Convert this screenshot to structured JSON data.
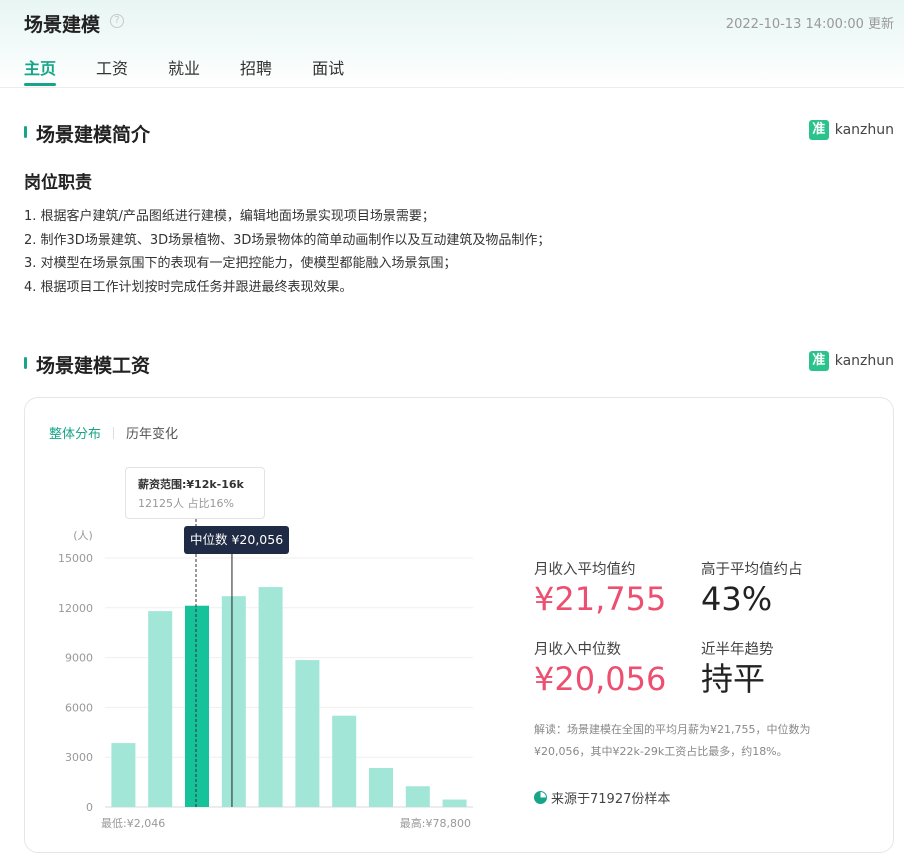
{
  "header": {
    "title": "场景建模",
    "update_time": "2022-10-13 14:00:00 更新",
    "tabs": [
      {
        "label": "主页",
        "active": true
      },
      {
        "label": "工资",
        "active": false
      },
      {
        "label": "就业",
        "active": false
      },
      {
        "label": "招聘",
        "active": false
      },
      {
        "label": "面试",
        "active": false
      }
    ]
  },
  "brand": {
    "name": "kanzhun",
    "icon_char": "准"
  },
  "intro": {
    "section_title": "场景建模简介",
    "duty_title": "岗位职责",
    "duties": [
      "1. 根据客户建筑/产品图纸进行建模，编辑地面场景实现项目场景需要；",
      "2. 制作3D场景建筑、3D场景植物、3D场景物体的简单动画制作以及互动建筑及物品制作；",
      "3. 对模型在场景氛围下的表现有一定把控能力，使模型都能融入场景氛围；",
      "4. 根据项目工作计划按时完成任务并跟进最终表现效果。"
    ]
  },
  "salary": {
    "section_title": "场景建模工资",
    "subtabs": [
      {
        "label": "整体分布",
        "active": true
      },
      {
        "label": "历年变化",
        "active": false
      }
    ],
    "tooltip": {
      "range": "薪资范围:¥12k-16k",
      "detail": "12125人  占比16%"
    },
    "median_label": "中位数 ¥20,056",
    "stats": {
      "avg_label": "月收入平均值约",
      "avg_value": "¥21,755",
      "above_label": "高于平均值约占",
      "above_value": "43%",
      "median_label": "月收入中位数",
      "median_value": "¥20,056",
      "trend_label": "近半年趋势",
      "trend_value": "持平"
    },
    "note": "解读：场景建模在全国的平均月薪为¥21,755，中位数为¥20,056，其中¥22k-29k工资占比最多，约18%。",
    "sample": "来源于71927份样本"
  },
  "colors": {
    "accent": "#16a589",
    "bar": "#a2e6d8",
    "bar_highlight": "#16c299",
    "pink": "#ec4f6f",
    "tooltip_dark": "#1f2a44"
  },
  "chart_data": {
    "type": "bar",
    "ylabel": "(人)",
    "ylim": [
      0,
      15000
    ],
    "yticks": [
      0,
      3000,
      6000,
      9000,
      12000,
      15000
    ],
    "values": [
      3850,
      11800,
      12125,
      12700,
      13250,
      8850,
      5500,
      2350,
      1250,
      450
    ],
    "highlight_index": 2,
    "median_position": 3.45,
    "x_min_label": "最低:¥2,046",
    "x_max_label": "最高:¥78,800"
  }
}
